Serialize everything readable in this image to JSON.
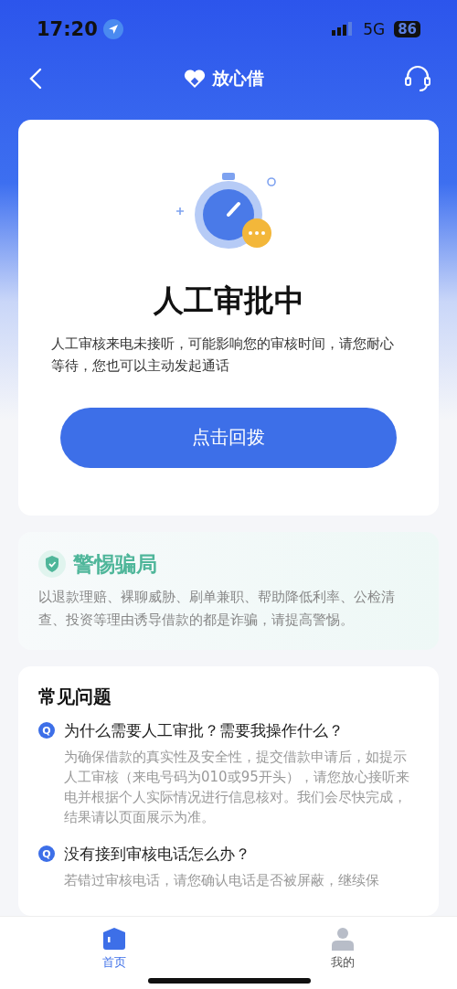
{
  "status_bar": {
    "time": "17:20",
    "network": "5G",
    "battery": "86"
  },
  "nav": {
    "title": "放心借"
  },
  "status_card": {
    "title": "人工审批中",
    "message": "人工审核来电未接听，可能影响您的审核时间，请您耐心等待，您也可以主动发起通话",
    "button": "点击回拨"
  },
  "warning": {
    "title": "警惕骗局",
    "text": "以退款理赔、裸聊威胁、刷单兼职、帮助降低利率、公检清查、投资等理由诱导借款的都是诈骗，请提高警惕。"
  },
  "faq": {
    "title": "常见问题",
    "items": [
      {
        "badge": "Q",
        "question": "为什么需要人工审批？需要我操作什么？",
        "answer": "为确保借款的真实性及安全性，提交借款申请后，如提示人工审核（来电号码为010或95开头），请您放心接听来电并根据个人实际情况进行信息核对。我们会尽快完成，结果请以页面展示为准。"
      },
      {
        "badge": "Q",
        "question": "没有接到审核电话怎么办？",
        "answer": "若错过审核电话，请您确认电话是否被屏蔽，继续保"
      }
    ]
  },
  "tabs": [
    {
      "label": "首页",
      "kind": "home",
      "selected": true
    },
    {
      "label": "我的",
      "kind": "profile",
      "selected": false
    }
  ]
}
